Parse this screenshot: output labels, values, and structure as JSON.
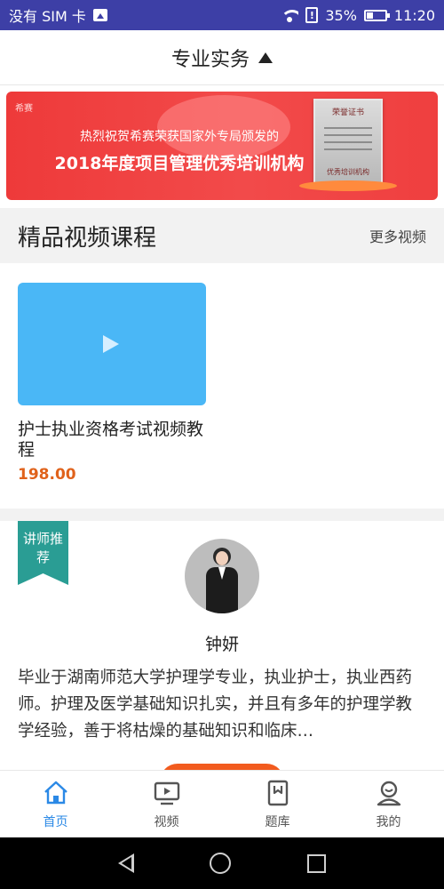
{
  "status_bar": {
    "carrier": "没有 SIM 卡",
    "battery_percent": "35%",
    "battery_level": 0.35,
    "time": "11:20"
  },
  "header": {
    "title": "专业实务"
  },
  "banner": {
    "brand": "希赛",
    "line1": "热烈祝贺希赛荣获国家外专局颁发的",
    "line2": "2018年度项目管理优秀培训机构",
    "cert_title": "荣誉证书",
    "cert_seal": "优秀培训机构"
  },
  "section": {
    "title": "精品视频课程",
    "more": "更多视频"
  },
  "courses": [
    {
      "title": "护士执业资格考试视频教程",
      "price": "198.00"
    }
  ],
  "teacher": {
    "ribbon": "讲师推荐",
    "name": "钟妍",
    "bio": "毕业于湖南师范大学护理学专业，执业护士，执业西药师。护理及医学基础知识扎实，并且有多年的护理学教学经验，善于将枯燥的基础知识和临床…"
  },
  "tabbar": {
    "items": [
      {
        "label": "首页",
        "icon": "home-icon",
        "active": true
      },
      {
        "label": "视频",
        "icon": "video-icon",
        "active": false
      },
      {
        "label": "题库",
        "icon": "question-bank-icon",
        "active": false
      },
      {
        "label": "我的",
        "icon": "profile-icon",
        "active": false
      }
    ]
  },
  "colors": {
    "status_bar": "#3d3fa6",
    "accent_blue": "#2b89e6",
    "price_orange": "#e0621b",
    "banner_red": "#ee3a3a",
    "ribbon_teal": "#2a9d94",
    "thumb_blue": "#4ab7f6"
  }
}
